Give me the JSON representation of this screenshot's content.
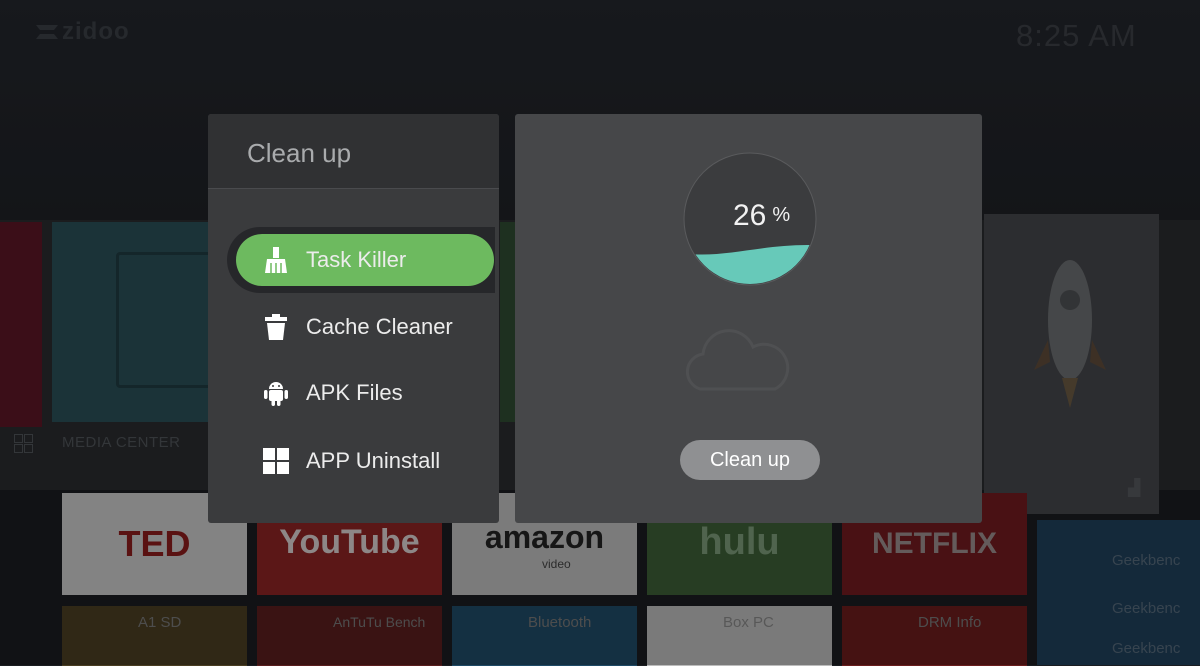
{
  "header": {
    "brand": "zidoo",
    "time": "8:25 AM"
  },
  "background": {
    "media_center_label": "MEDIA CENTER",
    "apps_row1": [
      "TED",
      "YouTube",
      "amazon",
      "hulu",
      "NETFLIX",
      "Geekbenc"
    ],
    "amazon_sub": "video",
    "apps_row2": [
      "A1 SD",
      "AnTuTu Bench",
      "Bluetooth",
      "Box PC",
      "DRM Info",
      "Geekbenc"
    ],
    "geek_labels": [
      "Geekbenc",
      "Geekbenc",
      "Geekbenc"
    ]
  },
  "menu": {
    "title": "Clean up",
    "items": [
      {
        "label": "Task Killer",
        "icon": "broom-icon",
        "active": true
      },
      {
        "label": "Cache Cleaner",
        "icon": "trash-icon",
        "active": false
      },
      {
        "label": "APK Files",
        "icon": "android-icon",
        "active": false
      },
      {
        "label": "APP Uninstall",
        "icon": "grid-icon",
        "active": false
      }
    ]
  },
  "cleaner": {
    "percent": "26",
    "percent_unit": "%",
    "percent_value": 26,
    "button_label": "Clean up"
  },
  "colors": {
    "accent_green": "#6dba5f",
    "gauge_fill": "#67c9b9",
    "panel_bg": "#464749"
  }
}
